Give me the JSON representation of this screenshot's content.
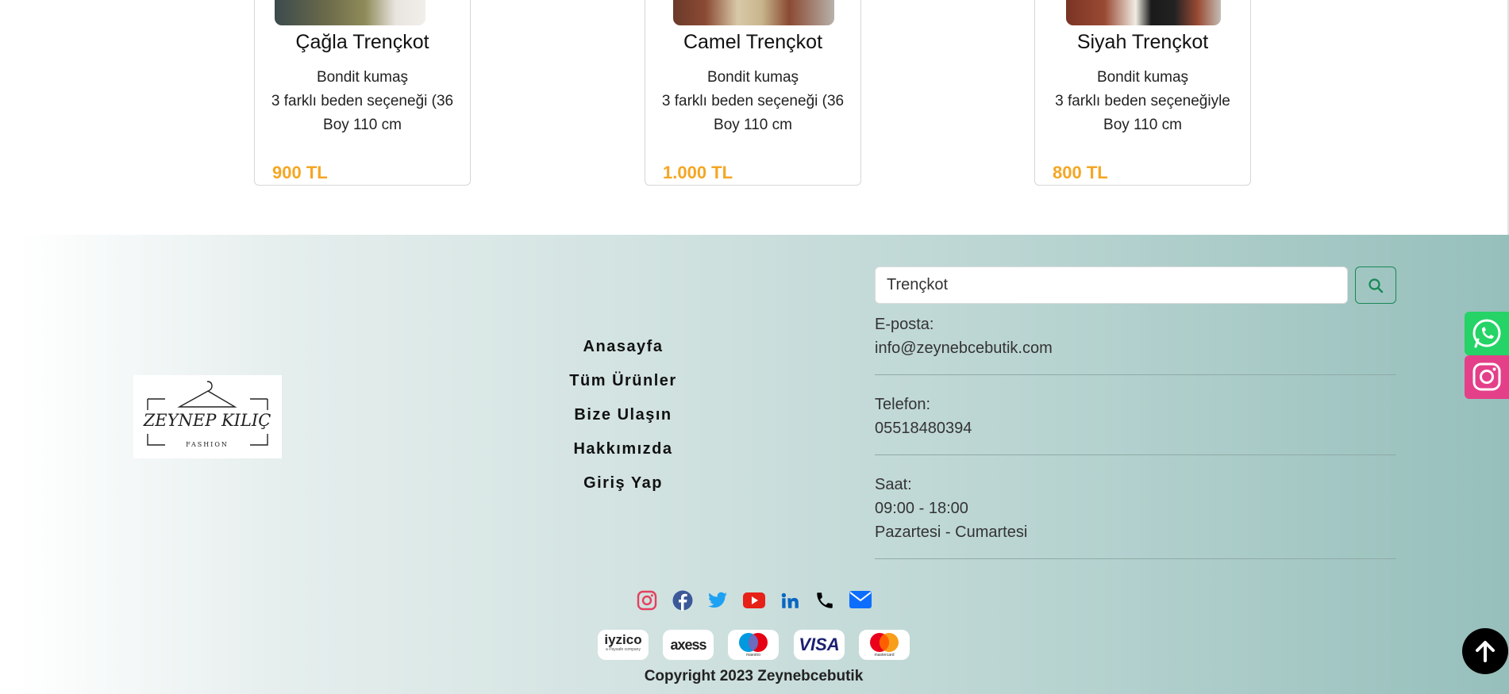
{
  "products": [
    {
      "title": "Çağla Trençkot",
      "desc": [
        "Bondit kumaş",
        "3 farklı beden seçeneği (36",
        "Boy 110 cm"
      ],
      "price": "900 TL"
    },
    {
      "title": "Camel Trençkot",
      "desc": [
        "Bondit kumaş",
        "3 farklı beden seçeneği (36",
        "Boy 110 cm"
      ],
      "price": "1.000 TL"
    },
    {
      "title": "Siyah Trençkot",
      "desc": [
        "Bondit kumaş",
        "3 farklı beden seçeneğiyle",
        "Boy 110 cm"
      ],
      "price": "800 TL"
    }
  ],
  "footer": {
    "logo": {
      "text": "ZEYNEP KILIÇ",
      "sub": "FASHION"
    },
    "nav": [
      "Anasayfa",
      "Tüm Ürünler",
      "Bize Ulaşın",
      "Hakkımızda",
      "Giriş Yap"
    ],
    "search": {
      "value": "Trençkot",
      "placeholder": "Trençkot",
      "icon": "search-icon"
    },
    "contact": {
      "email_label": "E-posta:",
      "email": "info@zeynebcebutik.com",
      "phone_label": "Telefon:",
      "phone": "05518480394",
      "hours_label": "Saat:",
      "hours": "09:00 - 18:00",
      "days": "Pazartesi - Cumartesi"
    },
    "social": [
      "instagram-icon",
      "facebook-icon",
      "twitter-icon",
      "youtube-icon",
      "linkedin-icon",
      "phone-icon",
      "envelope-icon"
    ],
    "payments": [
      "iyzico",
      "axess",
      "maestro",
      "VISA",
      "mastercard"
    ],
    "payments_sub": {
      "iyzico": "a Paysafe company"
    },
    "copyright": "Copyright 2023 Zeynebcebutik"
  },
  "colors": {
    "price": "#f5a623",
    "instagram": "#e4405f",
    "facebook": "#3b5998",
    "twitter": "#1da1f2",
    "youtube": "#e62117",
    "linkedin": "#0a66c2",
    "whatsapp": "#25d366"
  }
}
